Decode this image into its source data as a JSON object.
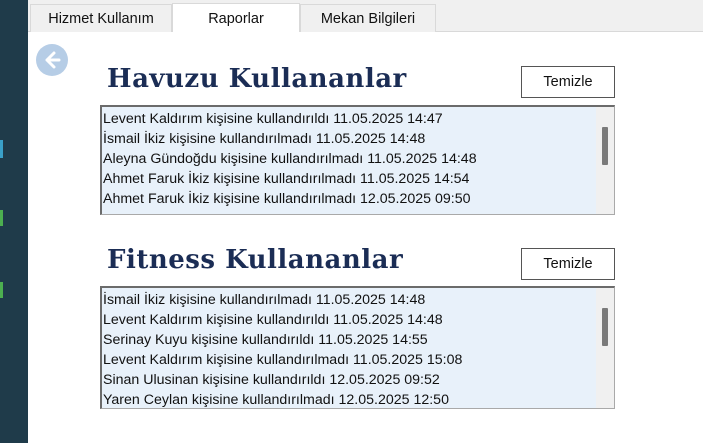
{
  "tabs": [
    {
      "label": "Hizmet Kullanım"
    },
    {
      "label": "Raporlar"
    },
    {
      "label": "Mekan Bilgileri"
    }
  ],
  "pool": {
    "title": "Havuzu Kullananlar",
    "clear_label": "Temizle",
    "entries": [
      "Levent Kaldırım kişisine kullandırıldı  11.05.2025 14:47",
      "İsmail İkiz kişisine kullandırılmadı  11.05.2025 14:48",
      "Aleyna Gündoğdu kişisine kullandırılmadı  11.05.2025 14:48",
      "Ahmet Faruk İkiz kişisine kullandırılmadı  11.05.2025 14:54",
      "Ahmet Faruk İkiz kişisine kullandırılmadı  12.05.2025 09:50"
    ]
  },
  "fitness": {
    "title": "Fitness Kullananlar",
    "clear_label": "Temizle",
    "entries": [
      "İsmail İkiz kişisine kullandırılmadı  11.05.2025 14:48",
      "Levent Kaldırım kişisine kullandırıldı  11.05.2025 14:48",
      "Serinay Kuyu kişisine kullandırıldı  11.05.2025 14:55",
      "Levent Kaldırım kişisine kullandırılmadı  11.05.2025 15:08",
      "Sinan Ulusinan kişisine kullandırıldı  12.05.2025 09:52",
      "Yaren Ceylan kişisine kullandırılmadı  12.05.2025 12:50"
    ]
  },
  "icons": {
    "back": "arrow-left-circle-icon"
  },
  "colors": {
    "title": "#1b2d55",
    "list_bg": "#e8f1fa",
    "back_button": "#b6cde6",
    "left_strip": "#1f3b4a"
  }
}
